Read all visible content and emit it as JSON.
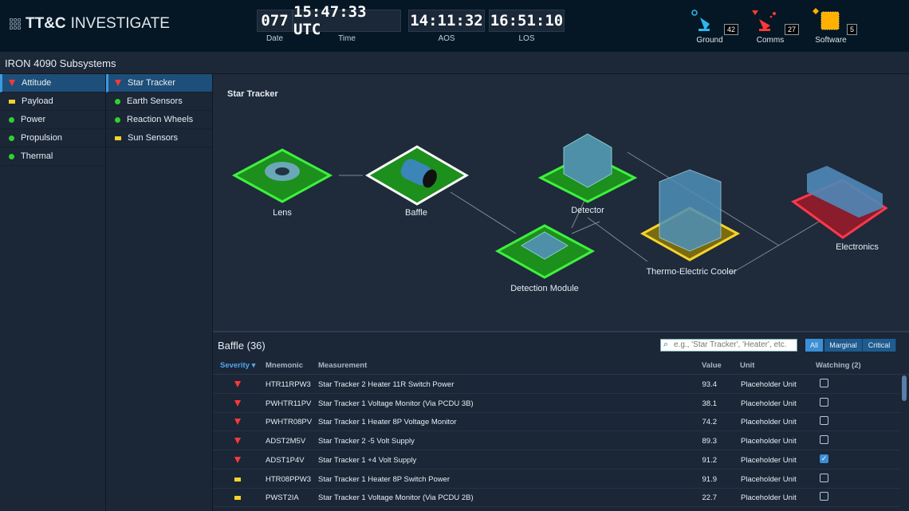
{
  "app": {
    "brand_bold": "TT&C",
    "brand_light": "INVESTIGATE"
  },
  "clocks": {
    "date": "077",
    "date_label": "Date",
    "time": "15:47:33 UTC",
    "time_label": "Time",
    "aos": "14:11:32",
    "aos_label": "AOS",
    "los": "16:51:10",
    "los_label": "LOS"
  },
  "status": [
    {
      "label": "Ground",
      "count": "42",
      "color": "#2bb8f0"
    },
    {
      "label": "Comms",
      "count": "27",
      "color": "#ff3838"
    },
    {
      "label": "Software",
      "count": "5",
      "color": "#ffb000"
    }
  ],
  "subsystems_title": "IRON 4090 Subsystems",
  "subsystems": [
    {
      "label": "Attitude",
      "status": "critical"
    },
    {
      "label": "Payload",
      "status": "marginal"
    },
    {
      "label": "Power",
      "status": "ok"
    },
    {
      "label": "Propulsion",
      "status": "ok"
    },
    {
      "label": "Thermal",
      "status": "ok"
    }
  ],
  "components": [
    {
      "label": "Star Tracker",
      "status": "critical"
    },
    {
      "label": "Earth Sensors",
      "status": "ok"
    },
    {
      "label": "Reaction Wheels",
      "status": "ok"
    },
    {
      "label": "Sun Sensors",
      "status": "marginal"
    }
  ],
  "diagram": {
    "title": "Star Tracker",
    "nodes": {
      "lens": "Lens",
      "baffle": "Baffle",
      "detector": "Detector",
      "detection_module": "Detection Module",
      "tec": "Thermo-Electric Cooler",
      "electronics": "Electronics"
    }
  },
  "table": {
    "title": "Baffle (36)",
    "search_placeholder": "e.g., 'Star Tracker', 'Heater', etc.",
    "filters": [
      "All",
      "Marginal",
      "Critical"
    ],
    "headers": {
      "severity": "Severity",
      "mnemonic": "Mnemonic",
      "measurement": "Measurement",
      "value": "Value",
      "unit": "Unit",
      "watching": "Watching (2)"
    },
    "rows": [
      {
        "severity": "critical",
        "mnemonic": "HTR11RPW3",
        "measurement": "Star Tracker 2 Heater 11R Switch Power",
        "value": "93.4",
        "unit": "Placeholder Unit",
        "watching": false
      },
      {
        "severity": "critical",
        "mnemonic": "PWHTR11PV",
        "measurement": "Star Tracker 1 Voltage Monitor (Via PCDU 3B)",
        "value": "38.1",
        "unit": "Placeholder Unit",
        "watching": false
      },
      {
        "severity": "critical",
        "mnemonic": "PWHTR08PV",
        "measurement": "Star Tracker 1 Heater 8P Voltage Monitor",
        "value": "74.2",
        "unit": "Placeholder Unit",
        "watching": false
      },
      {
        "severity": "critical",
        "mnemonic": "ADST2M5V",
        "measurement": "Star Tracker 2 -5 Volt Supply",
        "value": "89.3",
        "unit": "Placeholder Unit",
        "watching": false
      },
      {
        "severity": "critical",
        "mnemonic": "ADST1P4V",
        "measurement": "Star Tracker 1 +4 Volt Supply",
        "value": "91.2",
        "unit": "Placeholder Unit",
        "watching": true
      },
      {
        "severity": "marginal",
        "mnemonic": "HTR08PPW3",
        "measurement": "Star Tracker 1 Heater 8P Switch Power",
        "value": "91.9",
        "unit": "Placeholder Unit",
        "watching": false
      },
      {
        "severity": "marginal",
        "mnemonic": "PWST2IA",
        "measurement": "Star Tracker 1 Voltage Monitor (Via PCDU 2B)",
        "value": "22.7",
        "unit": "Placeholder Unit",
        "watching": false
      }
    ]
  }
}
